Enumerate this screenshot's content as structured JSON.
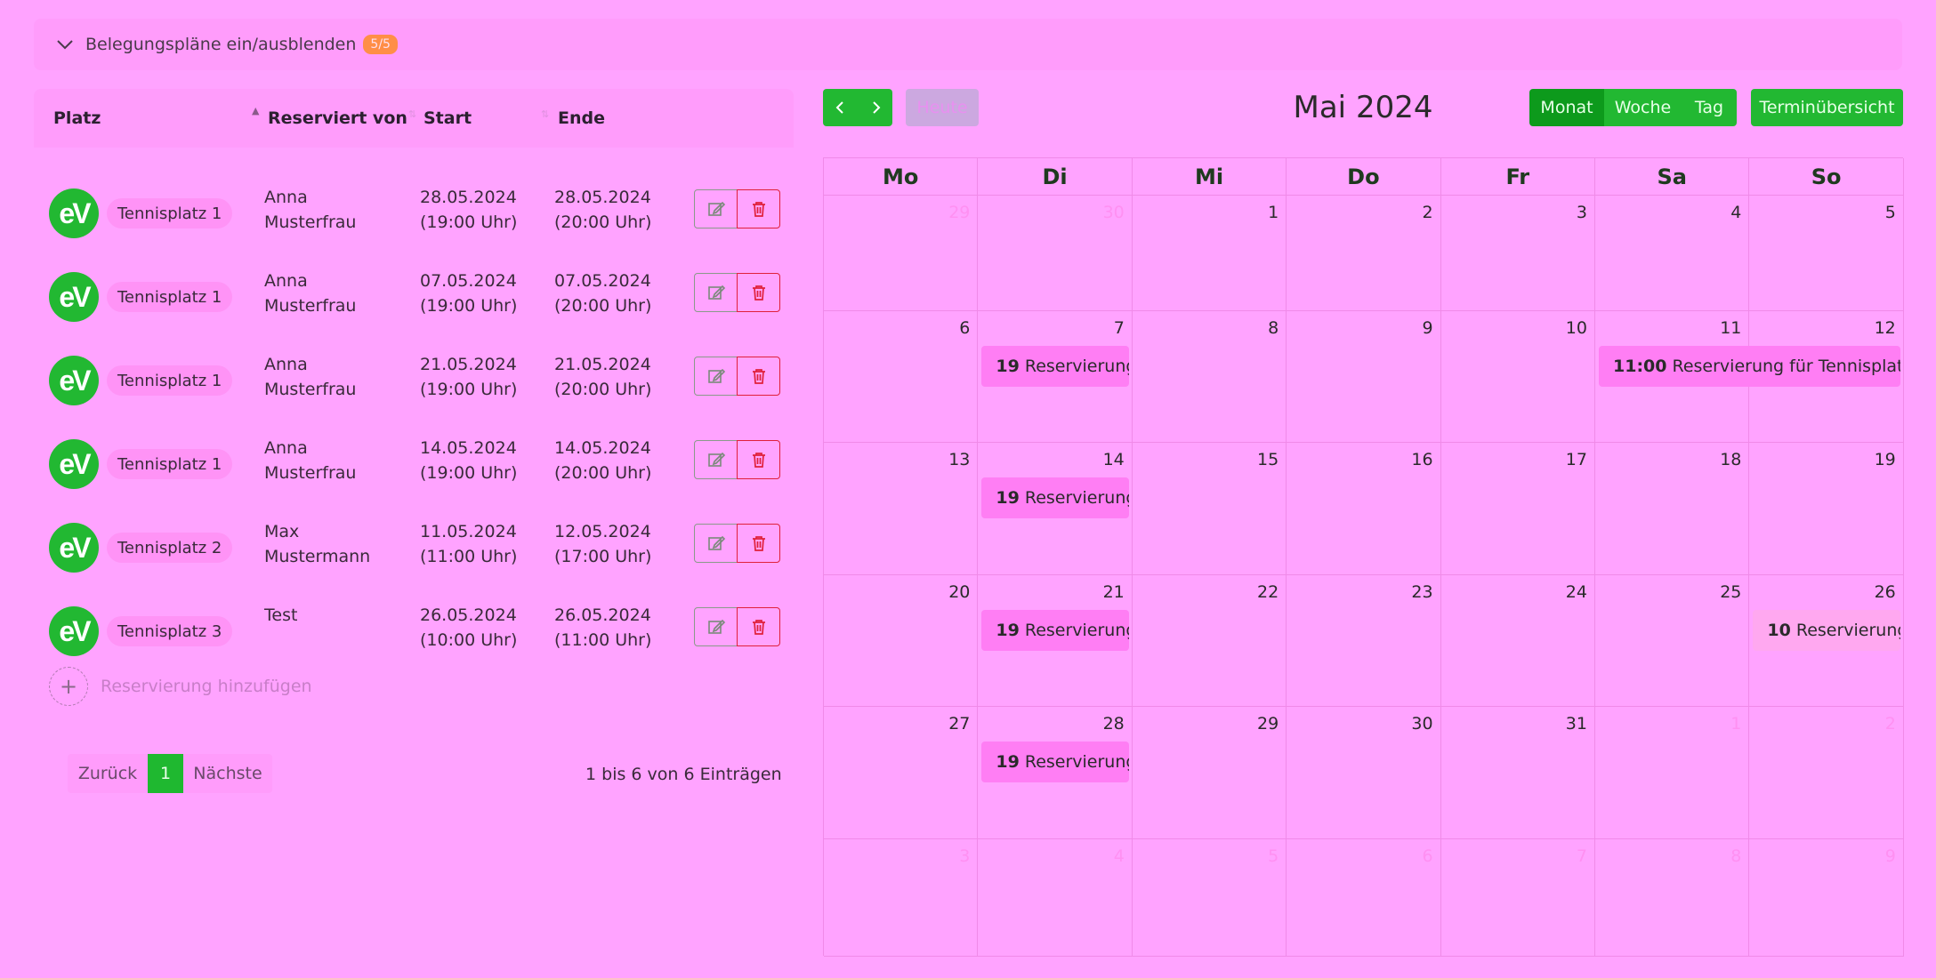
{
  "toggle": {
    "label": "Belegungspläne ein/ausblenden",
    "count": "5/5"
  },
  "table": {
    "headers": {
      "platz": "Platz",
      "reserviert_von": "Reserviert von",
      "start": "Start",
      "ende": "Ende"
    },
    "rows": [
      {
        "logo": "eV",
        "court": "Tennisplatz 1",
        "name1": "Anna",
        "name2": "Musterfrau",
        "start_date": "28.05.2024",
        "start_time": "(19:00 Uhr)",
        "end_date": "28.05.2024",
        "end_time": "(20:00 Uhr)"
      },
      {
        "logo": "eV",
        "court": "Tennisplatz 1",
        "name1": "Anna",
        "name2": "Musterfrau",
        "start_date": "07.05.2024",
        "start_time": "(19:00 Uhr)",
        "end_date": "07.05.2024",
        "end_time": "(20:00 Uhr)"
      },
      {
        "logo": "eV",
        "court": "Tennisplatz 1",
        "name1": "Anna",
        "name2": "Musterfrau",
        "start_date": "21.05.2024",
        "start_time": "(19:00 Uhr)",
        "end_date": "21.05.2024",
        "end_time": "(20:00 Uhr)"
      },
      {
        "logo": "eV",
        "court": "Tennisplatz 1",
        "name1": "Anna",
        "name2": "Musterfrau",
        "start_date": "14.05.2024",
        "start_time": "(19:00 Uhr)",
        "end_date": "14.05.2024",
        "end_time": "(20:00 Uhr)"
      },
      {
        "logo": "eV",
        "court": "Tennisplatz 2",
        "name1": "Max",
        "name2": "Mustermann",
        "start_date": "11.05.2024",
        "start_time": "(11:00 Uhr)",
        "end_date": "12.05.2024",
        "end_time": "(17:00 Uhr)"
      },
      {
        "logo": "eV",
        "court": "Tennisplatz 3",
        "name1": "Test",
        "name2": "",
        "start_date": "26.05.2024",
        "start_time": "(10:00 Uhr)",
        "end_date": "26.05.2024",
        "end_time": "(11:00 Uhr)"
      }
    ],
    "add_label": "Reservierung hinzufügen",
    "pager": {
      "prev": "Zurück",
      "page": "1",
      "next": "Nächste"
    },
    "info": "1 bis 6 von 6 Einträgen"
  },
  "calendar": {
    "title": "Mai 2024",
    "today": "Heute",
    "views": [
      "Monat",
      "Woche",
      "Tag"
    ],
    "active_view": "Monat",
    "overview": "Terminübersicht",
    "weekdays": [
      "Mo",
      "Di",
      "Mi",
      "Do",
      "Fr",
      "Sa",
      "So"
    ],
    "weeks": [
      [
        {
          "d": "29",
          "o": true
        },
        {
          "d": "30",
          "o": true
        },
        {
          "d": "1"
        },
        {
          "d": "2"
        },
        {
          "d": "3"
        },
        {
          "d": "4"
        },
        {
          "d": "5"
        }
      ],
      [
        {
          "d": "6"
        },
        {
          "d": "7"
        },
        {
          "d": "8"
        },
        {
          "d": "9"
        },
        {
          "d": "10"
        },
        {
          "d": "11"
        },
        {
          "d": "12"
        }
      ],
      [
        {
          "d": "13"
        },
        {
          "d": "14"
        },
        {
          "d": "15"
        },
        {
          "d": "16"
        },
        {
          "d": "17"
        },
        {
          "d": "18"
        },
        {
          "d": "19"
        }
      ],
      [
        {
          "d": "20"
        },
        {
          "d": "21"
        },
        {
          "d": "22"
        },
        {
          "d": "23"
        },
        {
          "d": "24"
        },
        {
          "d": "25"
        },
        {
          "d": "26"
        }
      ],
      [
        {
          "d": "27"
        },
        {
          "d": "28"
        },
        {
          "d": "29"
        },
        {
          "d": "30"
        },
        {
          "d": "31"
        },
        {
          "d": "1",
          "o": true
        },
        {
          "d": "2",
          "o": true
        }
      ],
      [
        {
          "d": "3",
          "o": true
        },
        {
          "d": "4",
          "o": true
        },
        {
          "d": "5",
          "o": true
        },
        {
          "d": "6",
          "o": true
        },
        {
          "d": "7",
          "o": true
        },
        {
          "d": "8",
          "o": true
        },
        {
          "d": "9",
          "o": true
        }
      ]
    ],
    "events": [
      {
        "week": 1,
        "day": 1,
        "span": 1,
        "time": "19",
        "title": "Reservierung"
      },
      {
        "week": 1,
        "day": 5,
        "span": 2,
        "time": "11:00",
        "title": "Reservierung für Tennisplatz"
      },
      {
        "week": 2,
        "day": 1,
        "span": 1,
        "time": "19",
        "title": "Reservierung"
      },
      {
        "week": 3,
        "day": 1,
        "span": 1,
        "time": "19",
        "title": "Reservierung"
      },
      {
        "week": 3,
        "day": 6,
        "span": 1,
        "time": "10",
        "title": "Reservierung",
        "pale": true
      },
      {
        "week": 4,
        "day": 1,
        "span": 1,
        "time": "19",
        "title": "Reservierung"
      }
    ]
  }
}
